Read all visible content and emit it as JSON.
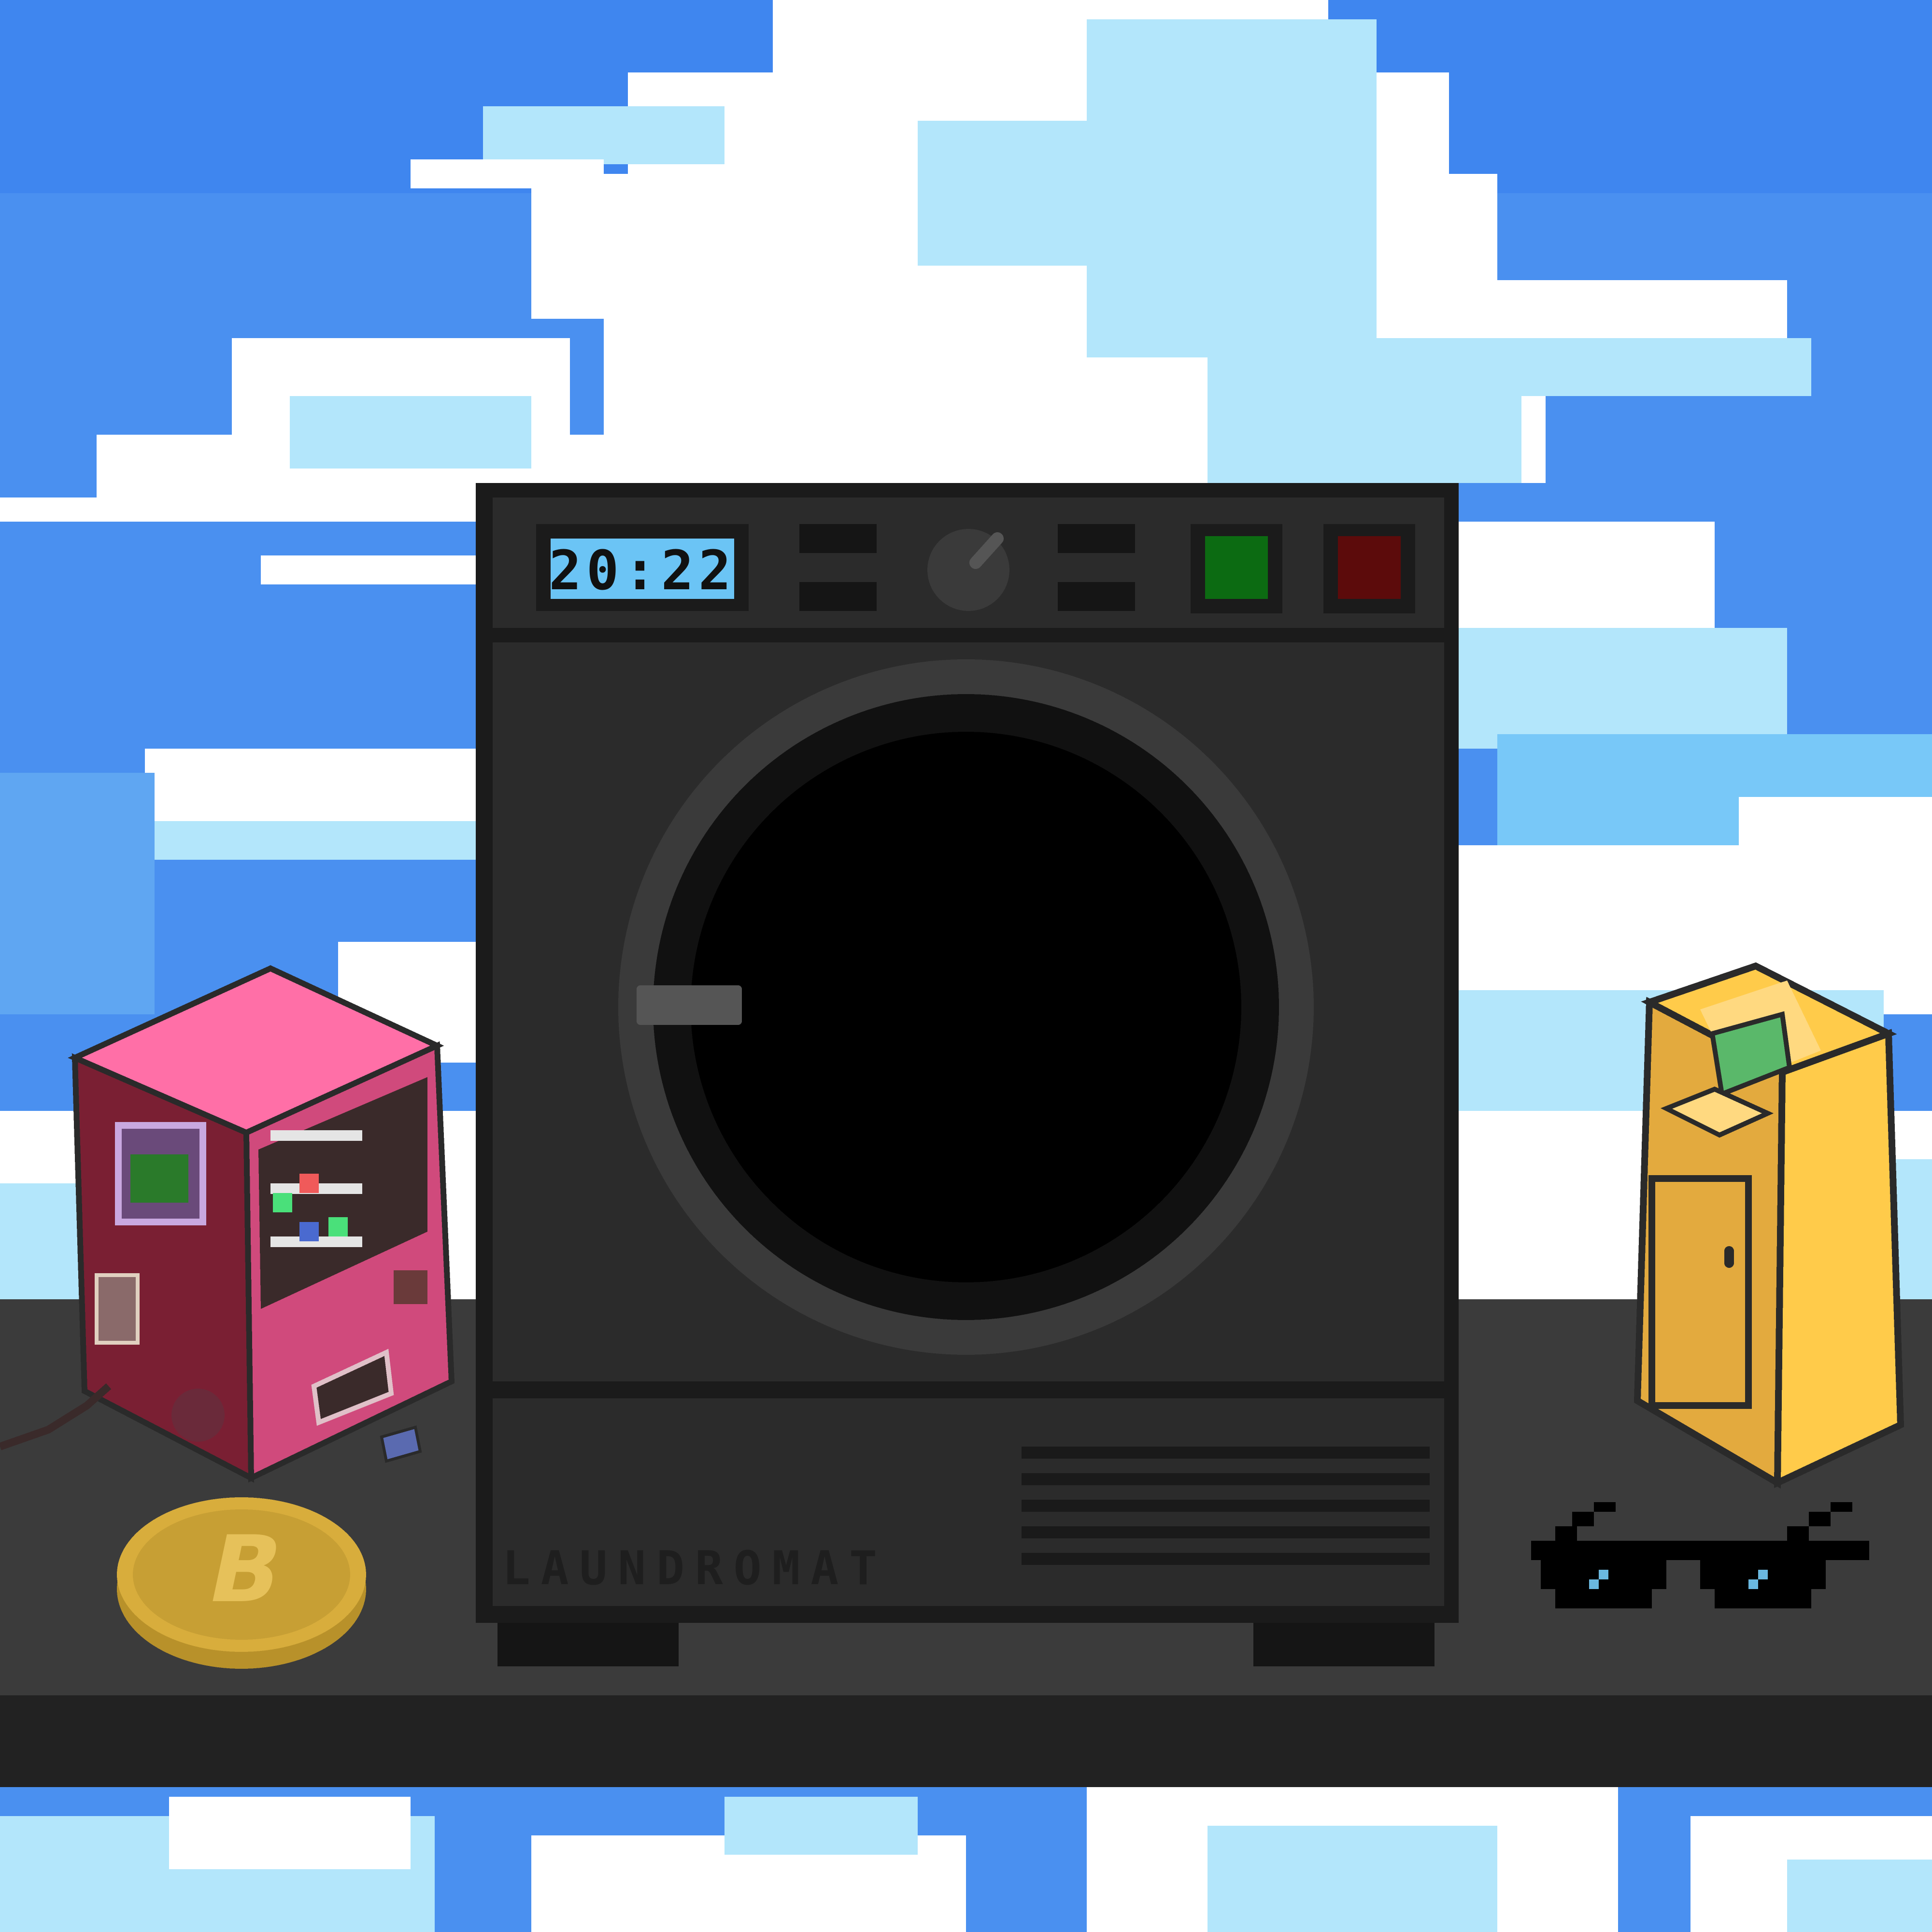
{
  "scene": {
    "colors": {
      "sky": "#4a90f0",
      "sky_deep": "#3b82f0",
      "cloud_white": "#ffffff",
      "cloud_light": "#b3e6fb",
      "cloud_mid": "#78c8f8",
      "counter_top": "#3b3b3b",
      "counter_front": "#222222",
      "machine_body": "#2b2b2b",
      "machine_outline": "#1b1b1b",
      "display_bg": "#6bc4f5",
      "button_green": "#0c6b12",
      "button_red": "#5c0b0b",
      "vending_pink": "#ff6fa7",
      "vending_dark": "#7a1f33",
      "atm_yellow": "#ffcb4a",
      "coin_gold": "#d8ad3c"
    }
  },
  "washer": {
    "display_time": "20:22",
    "brand": "LAUNDROMAT",
    "knob_icon": "dial-knob-icon",
    "start_button_icon": "green-button-icon",
    "stop_button_icon": "red-button-icon"
  },
  "props": {
    "coin_icon": "bitcoin-icon",
    "coin_symbol": "B",
    "glasses_icon": "pixel-sunglasses-icon",
    "vending_icon": "vending-machine-icon",
    "atm_icon": "atm-kiosk-icon"
  }
}
